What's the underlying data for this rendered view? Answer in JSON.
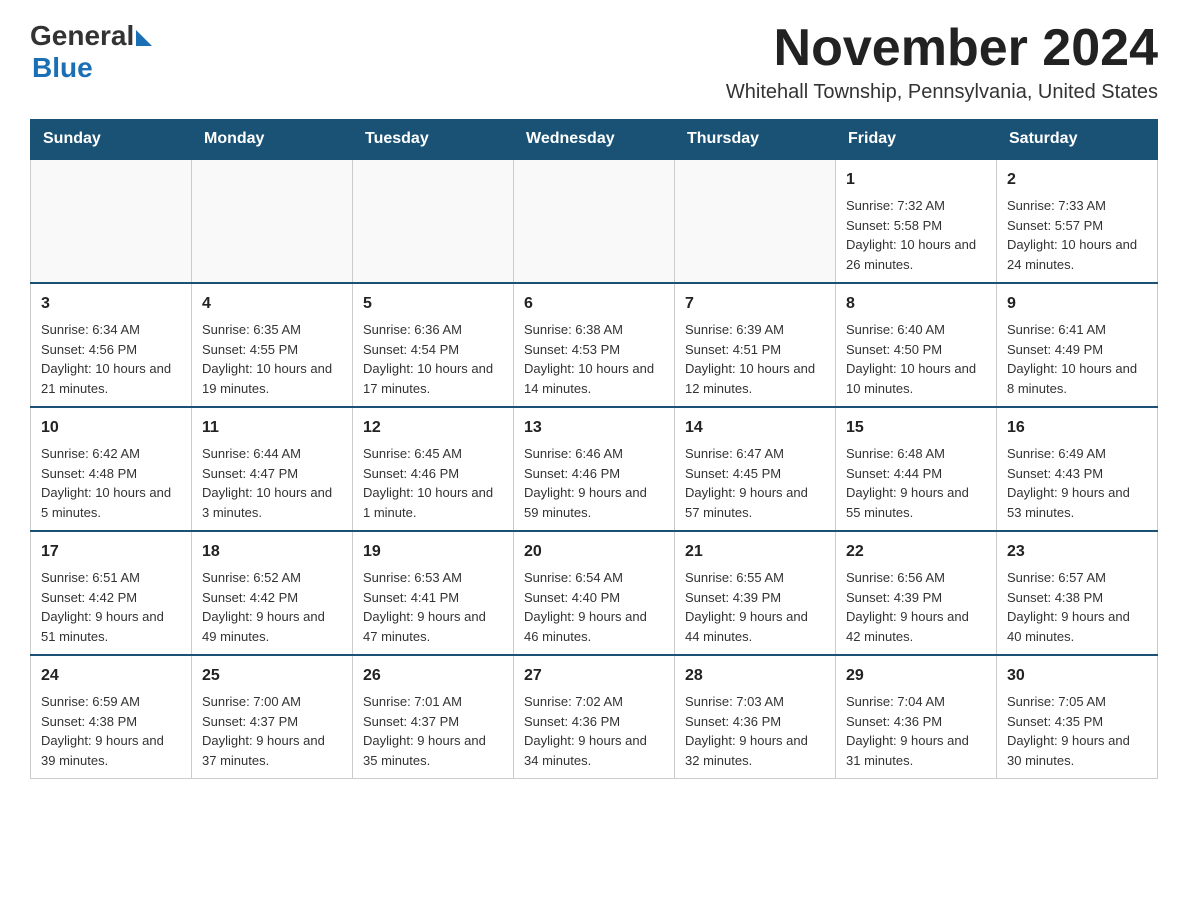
{
  "header": {
    "logo_general": "General",
    "logo_blue": "Blue",
    "month_title": "November 2024",
    "subtitle": "Whitehall Township, Pennsylvania, United States"
  },
  "weekdays": [
    "Sunday",
    "Monday",
    "Tuesday",
    "Wednesday",
    "Thursday",
    "Friday",
    "Saturday"
  ],
  "weeks": [
    [
      {
        "day": "",
        "info": ""
      },
      {
        "day": "",
        "info": ""
      },
      {
        "day": "",
        "info": ""
      },
      {
        "day": "",
        "info": ""
      },
      {
        "day": "",
        "info": ""
      },
      {
        "day": "1",
        "info": "Sunrise: 7:32 AM\nSunset: 5:58 PM\nDaylight: 10 hours and 26 minutes."
      },
      {
        "day": "2",
        "info": "Sunrise: 7:33 AM\nSunset: 5:57 PM\nDaylight: 10 hours and 24 minutes."
      }
    ],
    [
      {
        "day": "3",
        "info": "Sunrise: 6:34 AM\nSunset: 4:56 PM\nDaylight: 10 hours and 21 minutes."
      },
      {
        "day": "4",
        "info": "Sunrise: 6:35 AM\nSunset: 4:55 PM\nDaylight: 10 hours and 19 minutes."
      },
      {
        "day": "5",
        "info": "Sunrise: 6:36 AM\nSunset: 4:54 PM\nDaylight: 10 hours and 17 minutes."
      },
      {
        "day": "6",
        "info": "Sunrise: 6:38 AM\nSunset: 4:53 PM\nDaylight: 10 hours and 14 minutes."
      },
      {
        "day": "7",
        "info": "Sunrise: 6:39 AM\nSunset: 4:51 PM\nDaylight: 10 hours and 12 minutes."
      },
      {
        "day": "8",
        "info": "Sunrise: 6:40 AM\nSunset: 4:50 PM\nDaylight: 10 hours and 10 minutes."
      },
      {
        "day": "9",
        "info": "Sunrise: 6:41 AM\nSunset: 4:49 PM\nDaylight: 10 hours and 8 minutes."
      }
    ],
    [
      {
        "day": "10",
        "info": "Sunrise: 6:42 AM\nSunset: 4:48 PM\nDaylight: 10 hours and 5 minutes."
      },
      {
        "day": "11",
        "info": "Sunrise: 6:44 AM\nSunset: 4:47 PM\nDaylight: 10 hours and 3 minutes."
      },
      {
        "day": "12",
        "info": "Sunrise: 6:45 AM\nSunset: 4:46 PM\nDaylight: 10 hours and 1 minute."
      },
      {
        "day": "13",
        "info": "Sunrise: 6:46 AM\nSunset: 4:46 PM\nDaylight: 9 hours and 59 minutes."
      },
      {
        "day": "14",
        "info": "Sunrise: 6:47 AM\nSunset: 4:45 PM\nDaylight: 9 hours and 57 minutes."
      },
      {
        "day": "15",
        "info": "Sunrise: 6:48 AM\nSunset: 4:44 PM\nDaylight: 9 hours and 55 minutes."
      },
      {
        "day": "16",
        "info": "Sunrise: 6:49 AM\nSunset: 4:43 PM\nDaylight: 9 hours and 53 minutes."
      }
    ],
    [
      {
        "day": "17",
        "info": "Sunrise: 6:51 AM\nSunset: 4:42 PM\nDaylight: 9 hours and 51 minutes."
      },
      {
        "day": "18",
        "info": "Sunrise: 6:52 AM\nSunset: 4:42 PM\nDaylight: 9 hours and 49 minutes."
      },
      {
        "day": "19",
        "info": "Sunrise: 6:53 AM\nSunset: 4:41 PM\nDaylight: 9 hours and 47 minutes."
      },
      {
        "day": "20",
        "info": "Sunrise: 6:54 AM\nSunset: 4:40 PM\nDaylight: 9 hours and 46 minutes."
      },
      {
        "day": "21",
        "info": "Sunrise: 6:55 AM\nSunset: 4:39 PM\nDaylight: 9 hours and 44 minutes."
      },
      {
        "day": "22",
        "info": "Sunrise: 6:56 AM\nSunset: 4:39 PM\nDaylight: 9 hours and 42 minutes."
      },
      {
        "day": "23",
        "info": "Sunrise: 6:57 AM\nSunset: 4:38 PM\nDaylight: 9 hours and 40 minutes."
      }
    ],
    [
      {
        "day": "24",
        "info": "Sunrise: 6:59 AM\nSunset: 4:38 PM\nDaylight: 9 hours and 39 minutes."
      },
      {
        "day": "25",
        "info": "Sunrise: 7:00 AM\nSunset: 4:37 PM\nDaylight: 9 hours and 37 minutes."
      },
      {
        "day": "26",
        "info": "Sunrise: 7:01 AM\nSunset: 4:37 PM\nDaylight: 9 hours and 35 minutes."
      },
      {
        "day": "27",
        "info": "Sunrise: 7:02 AM\nSunset: 4:36 PM\nDaylight: 9 hours and 34 minutes."
      },
      {
        "day": "28",
        "info": "Sunrise: 7:03 AM\nSunset: 4:36 PM\nDaylight: 9 hours and 32 minutes."
      },
      {
        "day": "29",
        "info": "Sunrise: 7:04 AM\nSunset: 4:36 PM\nDaylight: 9 hours and 31 minutes."
      },
      {
        "day": "30",
        "info": "Sunrise: 7:05 AM\nSunset: 4:35 PM\nDaylight: 9 hours and 30 minutes."
      }
    ]
  ]
}
